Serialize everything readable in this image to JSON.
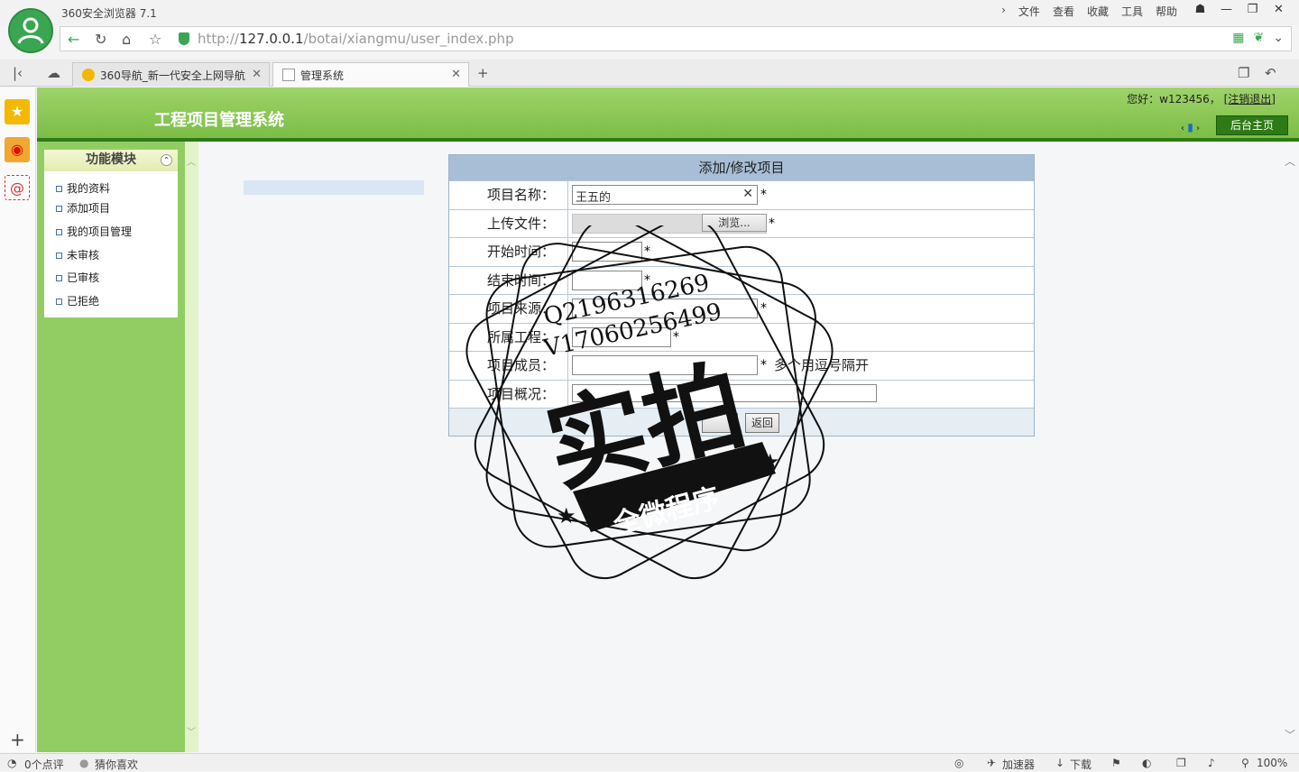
{
  "browser": {
    "app_title": "360安全浏览器 7.1",
    "menu": [
      "文件",
      "查看",
      "收藏",
      "工具",
      "帮助"
    ],
    "url_prefix": "http://",
    "url_host": "127.0.0.1",
    "url_path": "/botai/xiangmu/user_index.php",
    "tabs": [
      {
        "label": "360导航_新一代安全上网导航",
        "active": false
      },
      {
        "label": "管理系统",
        "active": true
      }
    ]
  },
  "header": {
    "system_title": "工程项目管理系统",
    "greeting": "您好：w123456，",
    "logout": "[注销退出]",
    "home_button": "后台主页"
  },
  "sidebar": {
    "title": "功能模块",
    "items": [
      {
        "label": "我的资料"
      },
      {
        "label": "添加项目"
      },
      {
        "label": "我的项目管理"
      },
      {
        "label": "未审核"
      },
      {
        "label": "已审核"
      },
      {
        "label": "已拒绝"
      }
    ]
  },
  "form": {
    "title": "添加/修改项目",
    "fields": [
      {
        "label": "项目名称：",
        "value": "王五的",
        "required": true
      },
      {
        "label": "上传文件：",
        "value": "",
        "browse": "浏览...",
        "required": true
      },
      {
        "label": "开始时间：",
        "value": "",
        "required": true
      },
      {
        "label": "结束时间：",
        "value": "",
        "required": true
      },
      {
        "label": "项目来源：",
        "value": "",
        "required": true
      },
      {
        "label": "所属工程：",
        "value": "",
        "required": true
      },
      {
        "label": "项目成员：",
        "value": "",
        "required": true,
        "hint": "多个用逗号隔开"
      },
      {
        "label": "项目概况：",
        "value": "",
        "required": false
      }
    ],
    "required_mark": "*",
    "return_button": "返回"
  },
  "watermark": {
    "qq": "Q2196316269",
    "wechat": "V17060256499",
    "big_text": "实拍",
    "banner": "全微程序"
  },
  "statusbar": {
    "comments": "0个点评",
    "recommend": "猜你喜欢",
    "accelerator": "加速器",
    "download": "下载",
    "zoom": "100%"
  },
  "colors": {
    "header_green": "#7bbd45",
    "sidebar_green": "#92cd64",
    "form_header_blue": "#a8bed6"
  }
}
